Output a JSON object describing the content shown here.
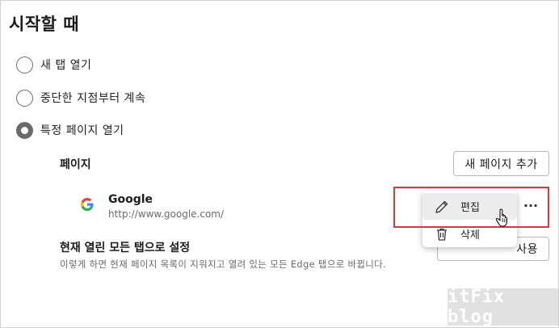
{
  "section": {
    "title": "시작할 때"
  },
  "options": [
    {
      "label": "새 탭 열기",
      "checked": false
    },
    {
      "label": "중단한 지점부터 계속",
      "checked": false
    },
    {
      "label": "특정 페이지 열기",
      "checked": true
    }
  ],
  "pages": {
    "heading": "페이지",
    "add_button": "새 페이지 추가",
    "items": [
      {
        "name": "Google",
        "url": "http://www.google.com/",
        "icon": "google-favicon"
      }
    ],
    "more_label": "···"
  },
  "context_menu": {
    "items": [
      {
        "label": "편집",
        "icon": "pencil-icon"
      },
      {
        "label": "삭제",
        "icon": "trash-icon"
      }
    ]
  },
  "current_tabs": {
    "heading": "현재 열린 모든 탭으로 설정",
    "description": "이렇게 하면 현재 페이지 목록이 지워지고 열려 있는 모든 Edge 탭으로 바뀝니다.",
    "button_label": "사용"
  },
  "watermark": {
    "text": "itFix blog"
  },
  "colors": {
    "highlight": "#e0353b",
    "menu_hover": "#ececec"
  }
}
